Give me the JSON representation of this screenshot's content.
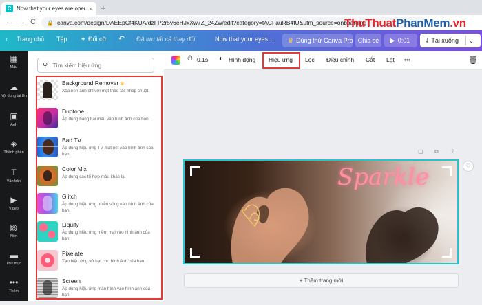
{
  "browser": {
    "tab_title": "Now that your eyes are open, m",
    "tab_close": "×",
    "new_tab": "+",
    "back": "←",
    "forward": "→",
    "reload": "C",
    "lock": "🔒",
    "url": "canva.com/design/DAEEpCf4KUA/dzFP2r5v6eHJxXw7Z_24Zw/edit?category=tACFauRB4fU&utm_source=onboarding"
  },
  "watermark": {
    "part1": "ThuThuat",
    "part2": "PhanMem",
    "part3": ".vn"
  },
  "topbar": {
    "home": "Trang chủ",
    "file": "Tệp",
    "resize": "Đổi cỡ",
    "undo": "↶",
    "saved_status": "Đã lưu tất cả thay đổi",
    "design_title": "Now that your eyes ...",
    "pro_button": "Dùng thử Canva Pro",
    "share_button": "Chia sẻ",
    "play_duration": "0:01",
    "download_button": "Tải xuống"
  },
  "sidebar": {
    "items": [
      {
        "label": "Mẫu",
        "icon": "▦"
      },
      {
        "label": "Nội dung tải lên",
        "icon": "☁"
      },
      {
        "label": "Ảnh",
        "icon": "▣"
      },
      {
        "label": "Thành phần",
        "icon": "◈"
      },
      {
        "label": "Văn bản",
        "icon": "T"
      },
      {
        "label": "Video",
        "icon": "▶"
      },
      {
        "label": "Nền",
        "icon": "▨"
      },
      {
        "label": "Thư mục",
        "icon": "▬"
      },
      {
        "label": "Thêm",
        "icon": "•••"
      }
    ]
  },
  "panel": {
    "search_placeholder": "Tìm kiếm hiệu ứng",
    "effects": [
      {
        "name": "Background Remover",
        "desc": "Xóa nền ảnh chỉ với một thao tác nhấp chuột.",
        "pro": true,
        "thumb": "bgremover"
      },
      {
        "name": "Duotone",
        "desc": "Áp dụng bảng hai màu vào hình ảnh của bạn.",
        "pro": false,
        "thumb": "duotone"
      },
      {
        "name": "Bad TV",
        "desc": "Áp dụng hiệu ứng TV mất nét vào hình ảnh của bạn.",
        "pro": false,
        "thumb": "badtv"
      },
      {
        "name": "Color Mix",
        "desc": "Áp dụng các tổ hợp màu khác lạ.",
        "pro": false,
        "thumb": "colormix"
      },
      {
        "name": "Glitch",
        "desc": "Áp dụng hiệu ứng nhiễu sóng vào hình ảnh của bạn.",
        "pro": false,
        "thumb": "glitch"
      },
      {
        "name": "Liquify",
        "desc": "Áp dụng hiệu ứng mềm mại vào hình ảnh của bạn.",
        "pro": false,
        "thumb": "liquify"
      },
      {
        "name": "Pixelate",
        "desc": "Tạo hiệu ứng vỡ hạt cho hình ảnh của bạn.",
        "pro": false,
        "thumb": "pixelate"
      },
      {
        "name": "Screen",
        "desc": "Áp dụng hiệu ứng màn hình vào hình ảnh của bạn.",
        "pro": false,
        "thumb": "screen"
      }
    ]
  },
  "toolbar": {
    "duration": "0.1s",
    "animate": "Hình động",
    "effects": "Hiệu ứng",
    "filter": "Lọc",
    "adjust": "Điều chỉnh",
    "crop": "Cắt",
    "flip": "Lật",
    "more": "•••"
  },
  "canvas": {
    "design_text": "Sparkle",
    "add_page": "+ Thêm trang mới"
  },
  "colors": {
    "accent": "#25c5cf",
    "highlight_box": "#e43a3a",
    "rail_bg": "#18191b"
  }
}
